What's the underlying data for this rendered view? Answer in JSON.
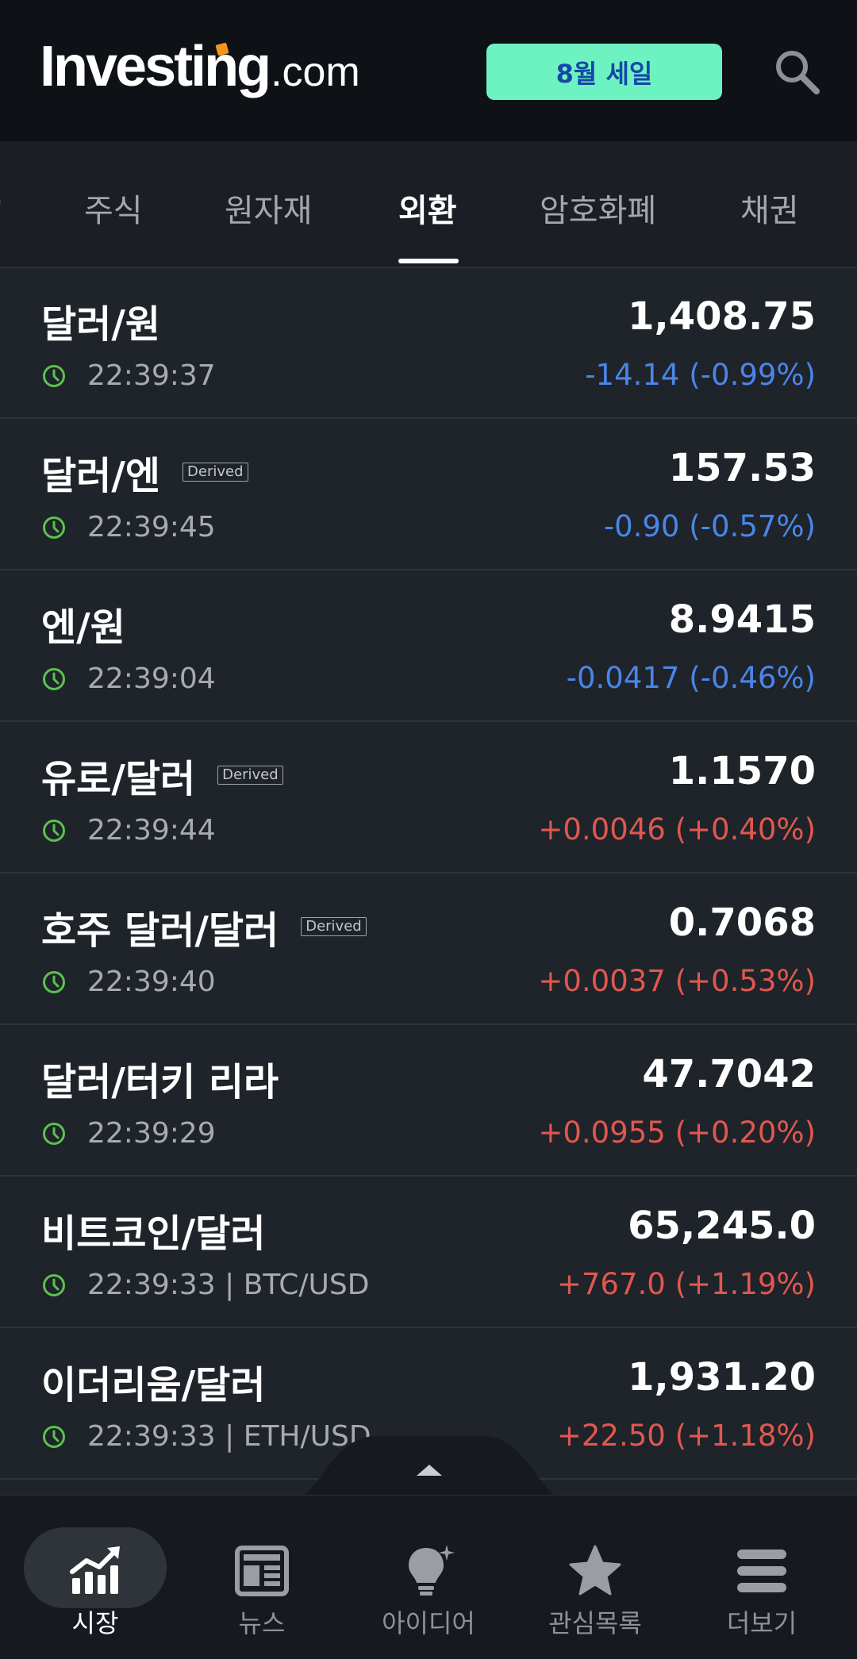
{
  "header": {
    "logo_main": "Investing",
    "logo_suffix": ".com",
    "sale_button": "8월 세일"
  },
  "tabs": [
    {
      "label": "주식"
    },
    {
      "label": "원자재"
    },
    {
      "label": "외환",
      "active": true
    },
    {
      "label": "암호화폐"
    },
    {
      "label": "채권"
    }
  ],
  "rows": [
    {
      "name": "달러/원",
      "badge": "",
      "time": "22:39:37",
      "price": "1,408.75",
      "change": "-14.14 (-0.99%)",
      "direction": "down"
    },
    {
      "name": "달러/엔",
      "badge": "Derived",
      "time": "22:39:45",
      "price": "157.53",
      "change": "-0.90 (-0.57%)",
      "direction": "down"
    },
    {
      "name": "엔/원",
      "badge": "",
      "time": "22:39:04",
      "price": "8.9415",
      "change": "-0.0417 (-0.46%)",
      "direction": "down"
    },
    {
      "name": "유로/달러",
      "badge": "Derived",
      "time": "22:39:44",
      "price": "1.1570",
      "change": "+0.0046 (+0.40%)",
      "direction": "up"
    },
    {
      "name": "호주 달러/달러",
      "badge": "Derived",
      "time": "22:39:40",
      "price": "0.7068",
      "change": "+0.0037 (+0.53%)",
      "direction": "up"
    },
    {
      "name": "달러/터키 리라",
      "badge": "",
      "time": "22:39:29",
      "price": "47.7042",
      "change": "+0.0955 (+0.20%)",
      "direction": "up"
    },
    {
      "name": "비트코인/달러",
      "badge": "",
      "time": "22:39:33 | BTC/USD",
      "price": "65,245.0",
      "change": "+767.0 (+1.19%)",
      "direction": "up"
    },
    {
      "name": "이더리움/달러",
      "badge": "",
      "time": "22:39:33 | ETH/USD",
      "price": "1,931.20",
      "change": "+22.50 (+1.18%)",
      "direction": "up"
    }
  ],
  "bottom_nav": [
    {
      "label": "시장",
      "icon": "chart-up-icon",
      "active": true
    },
    {
      "label": "뉴스",
      "icon": "newspaper-icon"
    },
    {
      "label": "아이디어",
      "icon": "lightbulb-icon"
    },
    {
      "label": "관심목록",
      "icon": "star-icon"
    },
    {
      "label": "더보기",
      "icon": "menu-icon"
    }
  ],
  "colors": {
    "up": "#e0584e",
    "down": "#4a86e8",
    "clock": "#5ac24e",
    "sale_bg": "#6df2c1"
  }
}
